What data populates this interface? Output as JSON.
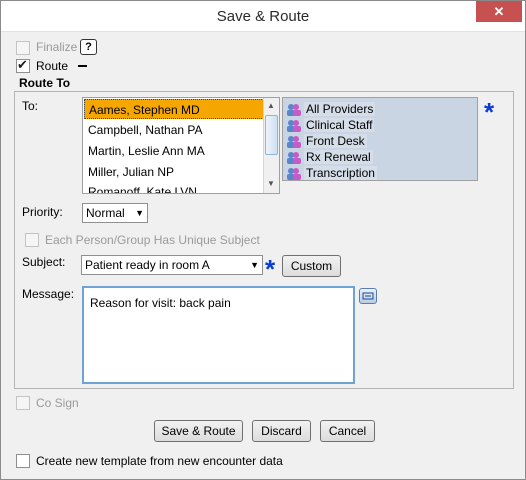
{
  "window": {
    "title": "Save & Route",
    "close_label": "✕"
  },
  "finalize": {
    "label": "Finalize",
    "help_label": "?"
  },
  "route": {
    "label": "Route"
  },
  "route_to": {
    "section_label": "Route To",
    "to_label": "To:",
    "providers": [
      "Aames, Stephen MD",
      "Campbell, Nathan PA",
      "Martin, Leslie Ann MA",
      "Miller, Julian NP",
      "Romanoff, Kate LVN"
    ],
    "groups": [
      "All Providers",
      "Clinical Staff",
      "Front Desk",
      "Rx Renewal",
      "Transcription"
    ],
    "required_marker": "*"
  },
  "priority": {
    "label": "Priority:",
    "value": "Normal"
  },
  "unique_subject": {
    "label": "Each Person/Group Has Unique Subject"
  },
  "subject": {
    "label": "Subject:",
    "value": "Patient ready in room A",
    "required_marker": "*",
    "custom_label": "Custom"
  },
  "message": {
    "label": "Message:",
    "value": "Reason for visit: back pain"
  },
  "co_sign": {
    "label": "Co Sign"
  },
  "buttons": {
    "save_route": "Save & Route",
    "discard": "Discard",
    "cancel": "Cancel"
  },
  "template": {
    "label": "Create new template from new encounter data"
  }
}
